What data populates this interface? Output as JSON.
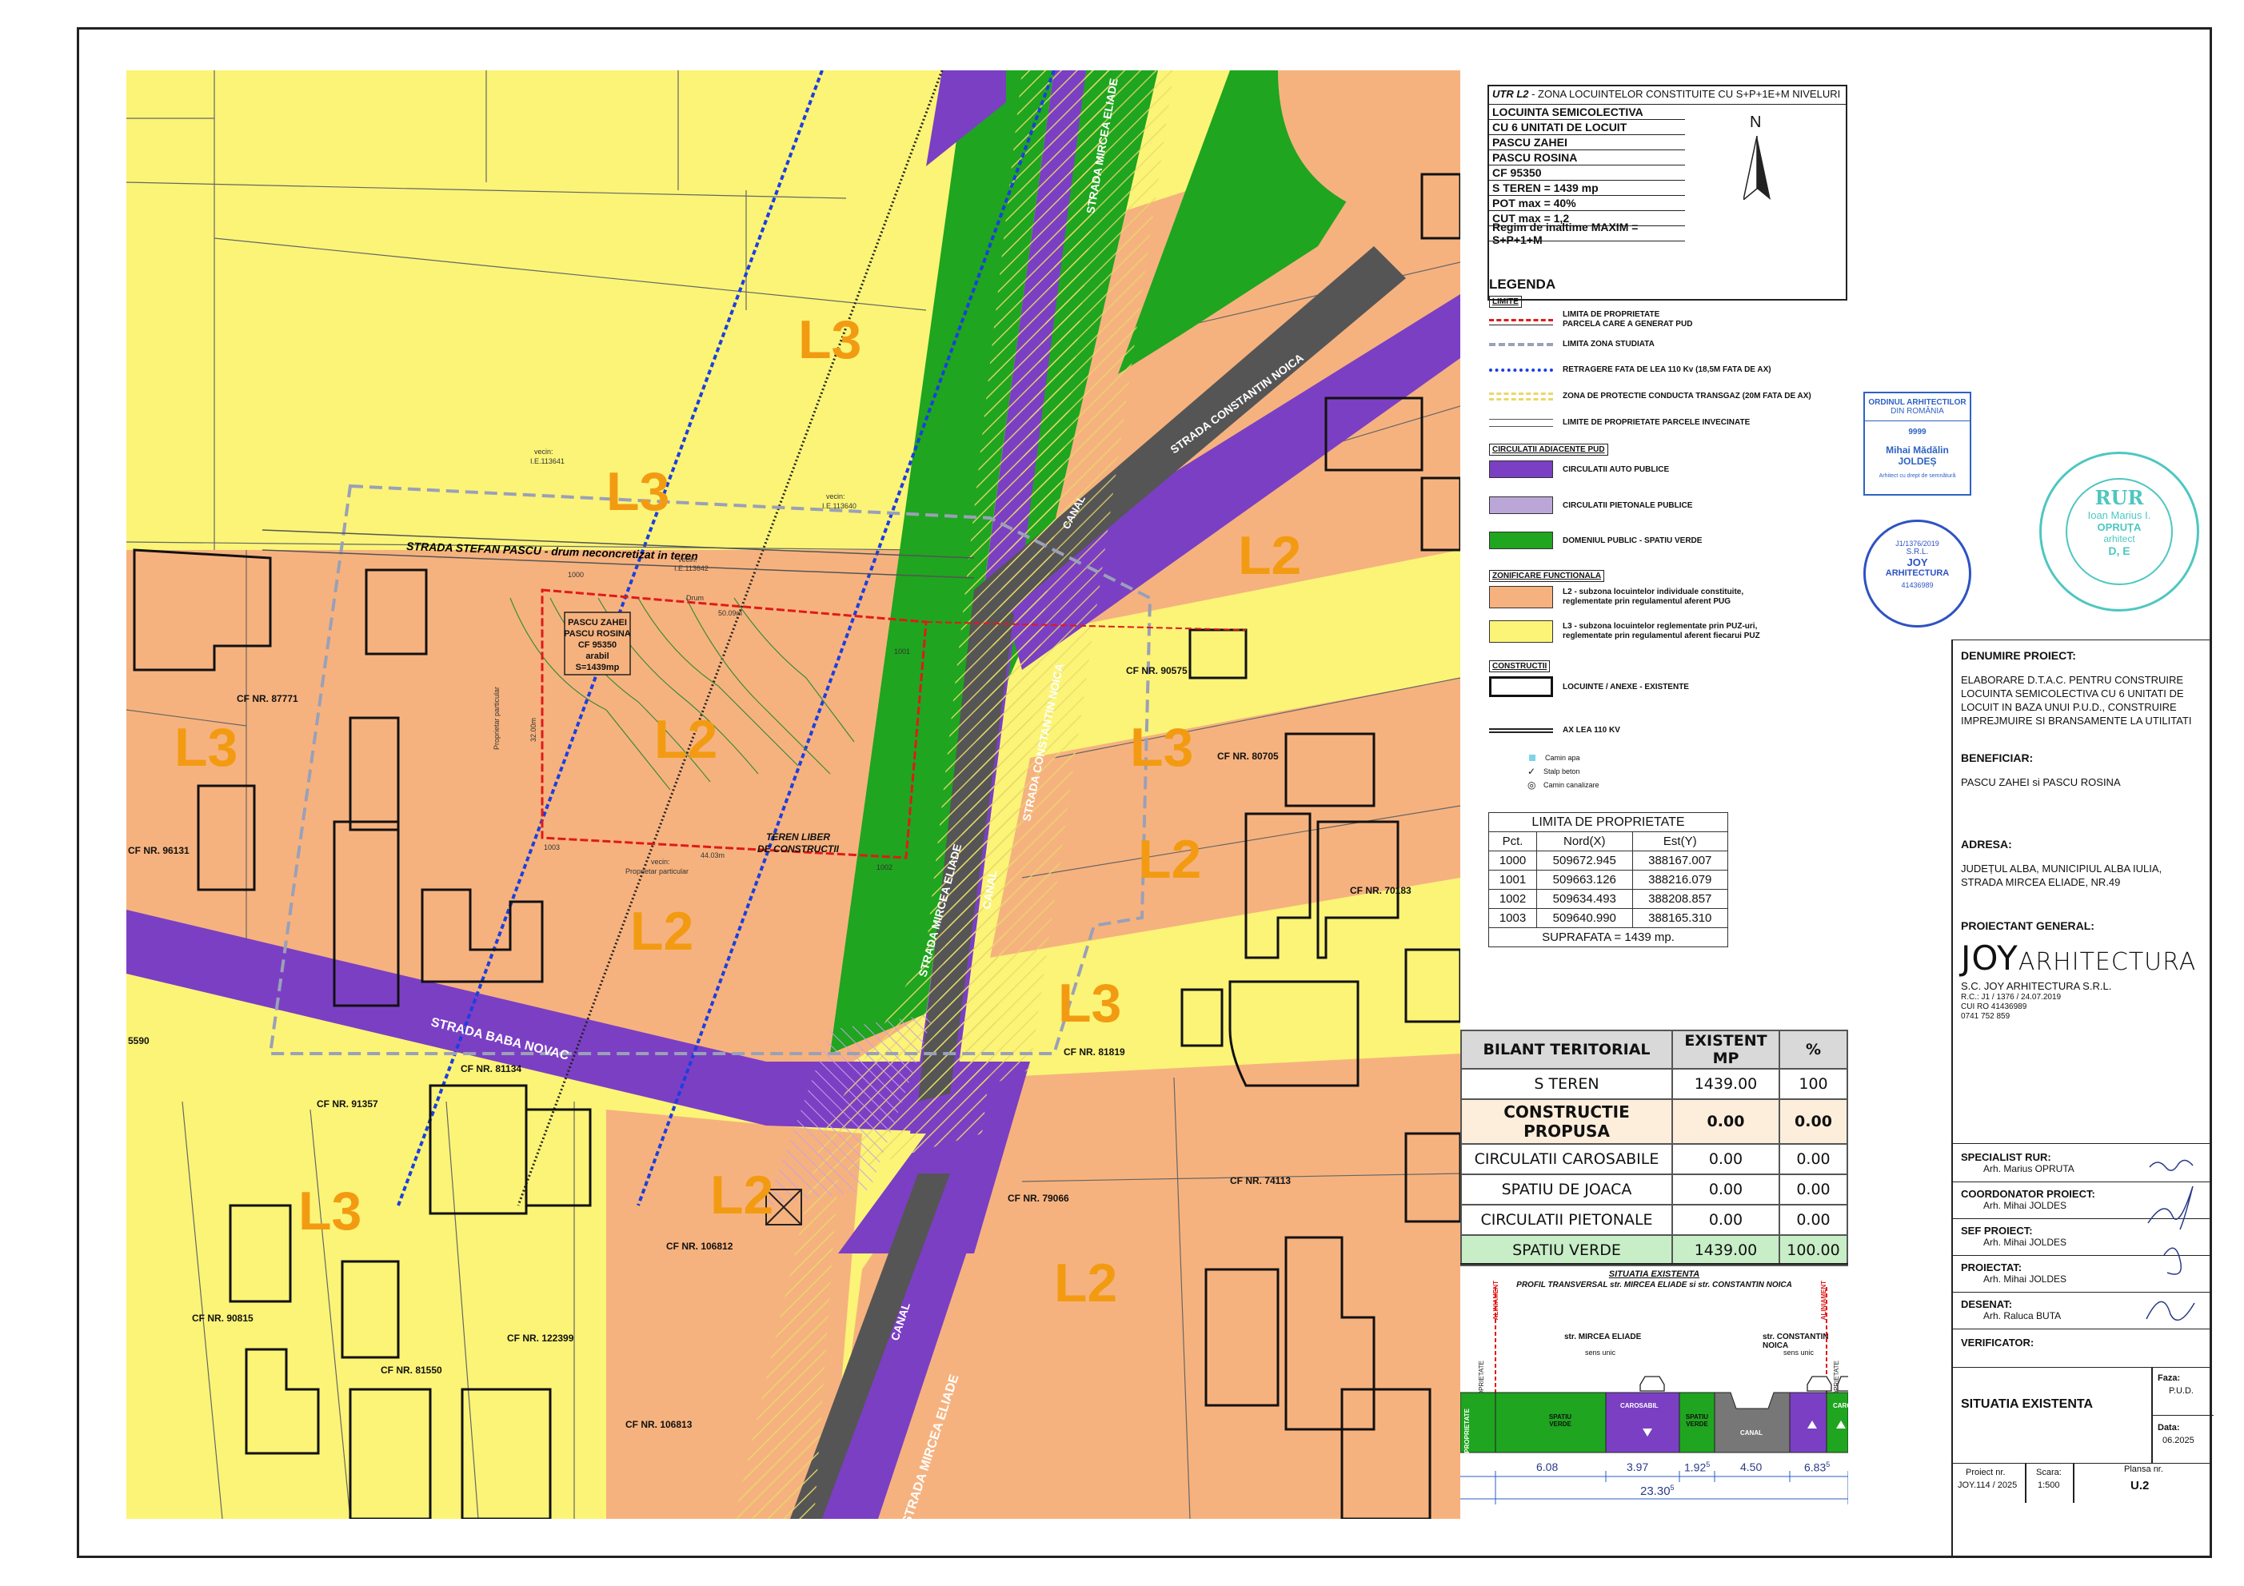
{
  "utr": {
    "title_prefix": "UTR L2",
    "title_rest": " - ZONA LOCUINTELOR CONSTITUITE CU S+P+1E+M NIVELURI",
    "lines": [
      "LOCUINTA SEMICOLECTIVA",
      "CU 6 UNITATI DE LOCUIT",
      "PASCU ZAHEI",
      "PASCU ROSINA",
      "CF 95350",
      "S TEREN = 1439 mp",
      "POT max = 40%",
      "CUT max = 1,2",
      "Regim de inaltime MAXIM = S+P+1+M"
    ],
    "north": "N"
  },
  "legend": {
    "title": "LEGENDA",
    "sections": {
      "limite": "LIMITE",
      "circulatii": "CIRCULATII ADIACENTE PUD",
      "zonificare": "ZONIFICARE FUNCTIONALA",
      "constructii": "CONSTRUCTII"
    },
    "items": {
      "limita_proprietate": "LIMITA DE PROPRIETATE",
      "limita_proprietate_2": "PARCELA CARE A GENERAT PUD",
      "limita_zona": "LIMITA ZONA STUDIATA",
      "retragere_lea": "RETRAGERE FATA DE LEA 110 Kv (18,5M FATA DE AX)",
      "protectie_gaz": "ZONA DE PROTECTIE CONDUCTA TRANSGAZ (20M FATA DE AX)",
      "parcele_invecinate": "LIMITE DE PROPRIETATE PARCELE INVECINATE",
      "auto": "CIRCULATII AUTO PUBLICE",
      "pietonale": "CIRCULATII PIETONALE PUBLICE",
      "verde": "DOMENIUL PUBLIC - SPATIU VERDE",
      "l2_a": "L2 - subzona locuintelor individuale constituite,",
      "l2_b": "reglementate prin regulamentul aferent PUG",
      "l3_a": "L3 - subzona locuintelor reglementate prin PUZ-uri,",
      "l3_b": "reglementate prin regulamentul aferent fiecarui PUZ",
      "locuinte": "LOCUINTE / ANEXE - EXISTENTE",
      "ax_lea": "AX LEA 110 KV",
      "camin_apa": "Camin apa",
      "stalp": "Stalp beton",
      "camin_canal": "Camin canalizare"
    },
    "colors": {
      "auto": "#7b3fc4",
      "pietonale": "#bba6d8",
      "verde": "#1fa51f",
      "l2": "#f6b27e",
      "l3": "#fbf477"
    }
  },
  "limits_table": {
    "title": "LIMITA DE PROPRIETATE",
    "headers": [
      "Pct.",
      "Nord(X)",
      "Est(Y)"
    ],
    "rows": [
      [
        "1000",
        "509672.945",
        "388167.007"
      ],
      [
        "1001",
        "509663.126",
        "388216.079"
      ],
      [
        "1002",
        "509634.493",
        "388208.857"
      ],
      [
        "1003",
        "509640.990",
        "388165.310"
      ]
    ],
    "footer": "SUPRAFATA = 1439 mp."
  },
  "balance_table": {
    "headers": [
      "BILANT TERITORIAL",
      "EXISTENT MP",
      "%"
    ],
    "rows": [
      [
        "S TEREN",
        "1439.00",
        "100"
      ],
      [
        "CONSTRUCTIE PROPUSA",
        "0.00",
        "0.00"
      ],
      [
        "CIRCULATII CAROSABILE",
        "0.00",
        "0.00"
      ],
      [
        "SPATIU DE JOACA",
        "0.00",
        "0.00"
      ],
      [
        "CIRCULATII PIETONALE",
        "0.00",
        "0.00"
      ],
      [
        "SPATIU VERDE",
        "1439.00",
        "100.00"
      ]
    ]
  },
  "section": {
    "title": "SITUATIA EXISTENTA",
    "subtitle": "PROFIL TRANSVERSAL str. MIRCEA ELIADE si str. CONSTANTIN NOICA",
    "street_left": "str. MIRCEA ELIADE",
    "street_right": "str. CONSTANTIN NOICA",
    "sens_unic": "sens unic",
    "limita_prop": "LIMITA PROPRIETATE",
    "aliniament": "ALINIAMENT",
    "proprietate": "PROPRIETATE",
    "spatiu_verde": "SPATIU VERDE",
    "carosabil": "CAROSABIL",
    "canal": "CANAL",
    "dims": [
      "6.08",
      "3.97",
      "1.92",
      "4.50",
      "6.83"
    ],
    "sup5": "5",
    "total": "23.30",
    "total_sup": "5"
  },
  "map": {
    "zones": [
      "L3",
      "L3",
      "L3",
      "L2",
      "L2",
      "L2",
      "L3",
      "L2",
      "L3",
      "L2",
      "L3",
      "L2",
      "L2"
    ],
    "streets": {
      "stefan_pascu": "STRADA STEFAN PASCU - drum neconcretizat in teren",
      "baba_novac": "STRADA BABA NOVAC",
      "mircea_eliade": "STRADA MIRCEA ELIADE",
      "constantin_noica": "STRADA CONSTANTIN NOICA",
      "canal": "CANAL"
    },
    "cf": {
      "c87771": "CF NR. 87771",
      "c96131": "CF NR. 96131",
      "c81134": "CF NR. 81134",
      "c91357": "CF NR. 91357",
      "c106812": "CF NR. 106812",
      "c90815": "CF NR. 90815",
      "c122399": "CF NR. 122399",
      "c81550": "CF NR. 81550",
      "c106813": "CF NR. 106813",
      "c79066": "CF NR. 79066",
      "c74113": "CF NR. 74113",
      "c81819": "CF NR. 81819",
      "c70183": "CF NR. 70183",
      "c80705": "CF NR. 80705",
      "c90575": "CF NR. 90575",
      "c5590": "5590"
    },
    "parcel_label": [
      "PASCU ZAHEI",
      "PASCU ROSINA",
      "CF 95350",
      "arabil",
      "S=1439mp"
    ],
    "teren_liber": [
      "TEREN LIBER",
      "DE CONSTRUCTII"
    ],
    "vecin": [
      "vecin:",
      "I.E.113641",
      "I.E.113640",
      "I.E.113642",
      "Drum",
      "Proprietar particular"
    ],
    "points": [
      "1000",
      "1001",
      "1002",
      "1003"
    ],
    "dims": [
      "50.09m",
      "44.03m",
      "32.00m"
    ]
  },
  "stamps": {
    "oar_1": "ORDINUL ARHITECTILOR",
    "oar_2": "DIN ROMÂNIA",
    "oar_3": "9999",
    "oar_4": "Mihai Mădălin",
    "oar_5": "JOLDEȘ",
    "oar_6": "Arhitect cu drept de semnătură",
    "rur_1": "RUR",
    "rur_2": "Ioan Marius I.",
    "rur_3": "OPRUȚA",
    "rur_4": "arhitect",
    "rur_5": "D, E",
    "co_1": "JOY",
    "co_2": "ARHITECTURA",
    "co_3": "S.R.L.",
    "co_4": "J1/1376/2019",
    "co_5": "41436989"
  },
  "title_block": {
    "denumire_label": "DENUMIRE PROIECT:",
    "denumire": "ELABORARE D.T.A.C. PENTRU CONSTRUIRE LOCUINTA SEMICOLECTIVA CU 6 UNITATI DE LOCUIT IN BAZA UNUI P.U.D., CONSTRUIRE IMPREJMUIRE SI BRANSAMENTE LA UTILITATI",
    "beneficiar_label": "BENEFICIAR:",
    "beneficiar": "PASCU ZAHEI si  PASCU ROSINA",
    "adresa_label": "ADRESA:",
    "adresa": "JUDEȚUL ALBA, MUNICIPIUL ALBA IULIA, STRADA MIRCEA ELIADE, NR.49",
    "proiectant_label": "PROIECTANT GENERAL:",
    "logo_a": "JOY",
    "logo_b": "ARHITECTURA",
    "firm": "S.C. JOY ARHITECTURA S.R.L.",
    "firm_lines": [
      "R.C.: J1 / 1376 / 24.07.2019",
      "CUI RO 41436989",
      "0741 752 859"
    ],
    "specialist_label": "SPECIALIST RUR:",
    "specialist": "Arh. Marius OPRUTA",
    "coordonator_label": "COORDONATOR PROIECT:",
    "coordonator": "Arh. Mihai JOLDES",
    "sef_label": "SEF PROIECT:",
    "sef": "Arh. Mihai JOLDES",
    "proiectat_label": "PROIECTAT:",
    "proiectat": "Arh. Mihai JOLDES",
    "desenat_label": "DESENAT:",
    "desenat": "Arh. Raluca  BUTA",
    "verificator_label": "VERIFICATOR:",
    "sheet_title": "SITUATIA EXISTENTA",
    "faza_label": "Faza:",
    "faza": "P.U.D.",
    "data_label": "Data:",
    "data": "06.2025",
    "proiect_label": "Proiect  nr.",
    "proiect": "JOY.114 / 2025",
    "scara_label": "Scara:",
    "scara": "1:500",
    "plansa_label": "Plansa nr.",
    "plansa": "U.2"
  }
}
